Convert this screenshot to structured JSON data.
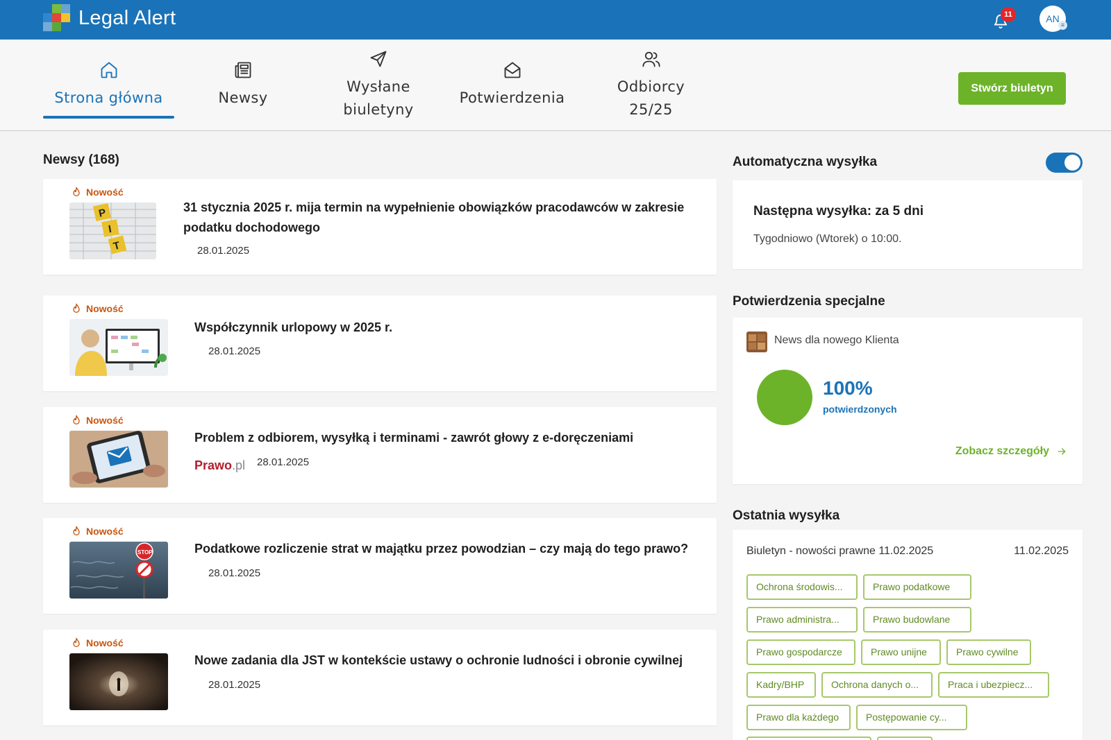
{
  "app": {
    "title": "Legal Alert",
    "notifications_count": "11",
    "user_initials": "AN",
    "colors": {
      "brand": "#1a73b8",
      "accent_green": "#6cb32a",
      "new_badge": "#c7560e"
    }
  },
  "nav": {
    "items": [
      {
        "label": "Strona główna",
        "icon": "home-icon",
        "active": true
      },
      {
        "label": "Newsy",
        "icon": "newspaper-icon"
      },
      {
        "label": "Wysłane biuletyny",
        "label_line1": "Wysłane",
        "label_line2": "biuletyny",
        "icon": "send-icon"
      },
      {
        "label": "Potwierdzenia",
        "icon": "envelope-open-icon"
      },
      {
        "label": "Odbiorcy 25/25",
        "icon": "users-icon"
      }
    ],
    "create_button": "Stwórz biuletyn"
  },
  "news": {
    "heading": "Newsy (168)",
    "items": [
      {
        "badge": "Nowość",
        "title_line1": "31 stycznia 2025 r. mija termin na wypełnienie obowiązków pracodawców w zakresie",
        "title_line2": "podatku dochodowego",
        "date": "28.01.2025",
        "thumb": "pit-blocks"
      },
      {
        "badge": "Nowość",
        "title": "Współczynnik urlopowy w 2025 r.",
        "date": "28.01.2025",
        "thumb": "office-calendar"
      },
      {
        "badge": "Nowość",
        "title": "Problem z odbiorem, wysyłką i terminami - zawrót głowy z e-doręczeniami",
        "date": "28.01.2025",
        "source_logo": "Prawo.pl",
        "source_main": "Praw",
        "source_o": "o",
        "source_suffix": ".pl",
        "thumb": "tablet-mail"
      },
      {
        "badge": "Nowość",
        "title": "Podatkowe rozliczenie strat w majątku przez powodzian – czy mają do tego prawo?",
        "date": "28.01.2025",
        "thumb": "flood-stop-sign"
      },
      {
        "badge": "Nowość",
        "title": "Nowe zadania dla JST w kontekście ustawy o ochronie ludności i obronie cywilnej",
        "date": "28.01.2025",
        "thumb": "tunnel"
      }
    ]
  },
  "auto_send": {
    "title": "Automatyczna wysyłka",
    "enabled": true,
    "next_label": "Następna wysyłka: za 5 dni",
    "schedule": "Tygodniowo (Wtorek) o 10:00."
  },
  "special_confirmations": {
    "title": "Potwierdzenia specjalne",
    "news_title": "News dla nowego Klienta",
    "percent": "100%",
    "percent_value": 1.0,
    "percent_label": "potwierdzonych",
    "details_link": "Zobacz szczegóły"
  },
  "last_send": {
    "title": "Ostatnia wysyłka",
    "bulletin_name": "Biuletyn - nowości prawne 11.02.2025",
    "bulletin_date": "11.02.2025",
    "tags": [
      "Ochrona środowis...",
      "Prawo podatkowe",
      "Prawo administra...",
      "Prawo budowlane",
      "Prawo gospodarcze",
      "Prawo unijne",
      "Prawo cywilne",
      "Kadry/BHP",
      "Ochrona danych o...",
      "Praca i ubezpiecz...",
      "Prawo dla każdego",
      "Postępowanie cy..."
    ]
  }
}
